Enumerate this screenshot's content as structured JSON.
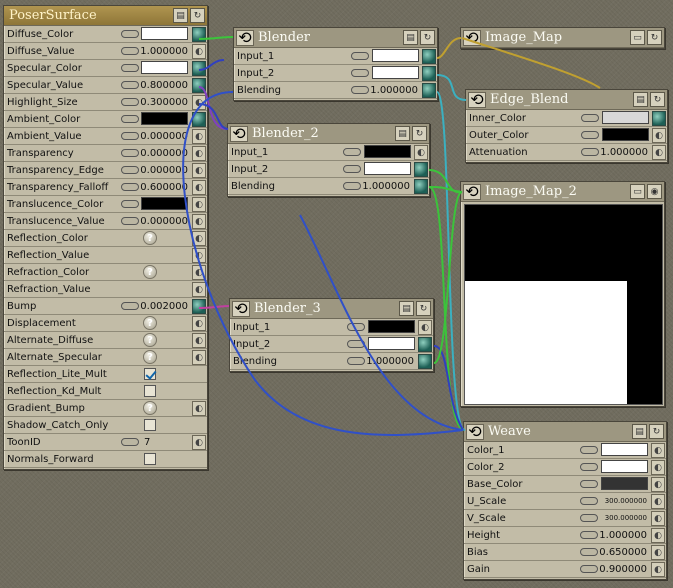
{
  "nodes": {
    "poser_surface": {
      "title": "PoserSurface"
    },
    "blender": {
      "title": "Blender"
    },
    "image_map": {
      "title": "Image_Map"
    },
    "blender_2": {
      "title": "Blender_2"
    },
    "edge_blend": {
      "title": "Edge_Blend"
    },
    "image_map_2": {
      "title": "Image_Map_2"
    },
    "blender_3": {
      "title": "Blender_3"
    },
    "weave": {
      "title": "Weave"
    }
  },
  "poser": [
    {
      "label": "Diffuse_Color",
      "swatch": "#ffffff",
      "connected": true
    },
    {
      "label": "Diffuse_Value",
      "value": "1.000000"
    },
    {
      "label": "Specular_Color",
      "swatch": "#ffffff",
      "connected": true
    },
    {
      "label": "Specular_Value",
      "value": "0.800000",
      "connected": true
    },
    {
      "label": "Highlight_Size",
      "value": "0.300000"
    },
    {
      "label": "Ambient_Color",
      "swatch": "#000000",
      "connected": true
    },
    {
      "label": "Ambient_Value",
      "value": "0.000000"
    },
    {
      "label": "Transparency",
      "value": "0.000000"
    },
    {
      "label": "Transparency_Edge",
      "value": "0.000000"
    },
    {
      "label": "Transparency_Falloff",
      "value": "0.600000"
    },
    {
      "label": "Translucence_Color",
      "swatch": "#000000"
    },
    {
      "label": "Translucence_Value",
      "value": "0.000000"
    },
    {
      "label": "Reflection_Color",
      "q": true
    },
    {
      "label": "Reflection_Value"
    },
    {
      "label": "Refraction_Color",
      "q": true
    },
    {
      "label": "Refraction_Value"
    },
    {
      "label": "Bump",
      "value": "0.002000",
      "connected": true
    },
    {
      "label": "Displacement",
      "q": true
    },
    {
      "label": "Alternate_Diffuse",
      "q": true
    },
    {
      "label": "Alternate_Specular",
      "q": true
    },
    {
      "label": "Reflection_Lite_Mult",
      "checkbox": true,
      "checked": true
    },
    {
      "label": "Reflection_Kd_Mult",
      "checkbox": true,
      "checked": false
    },
    {
      "label": "Gradient_Bump",
      "q": true
    },
    {
      "label": "Shadow_Catch_Only",
      "checkbox": true,
      "checked": false
    },
    {
      "label": "ToonID",
      "value": "7",
      "link": true
    },
    {
      "label": "Normals_Forward",
      "checkbox": true,
      "checked": false
    }
  ],
  "blender_rows": [
    {
      "label": "Input_1",
      "swatch": "#ffffff",
      "connected": true
    },
    {
      "label": "Input_2",
      "swatch": "#ffffff",
      "connected": true
    },
    {
      "label": "Blending",
      "value": "1.000000",
      "connected": true
    }
  ],
  "blender2_rows": [
    {
      "label": "Input_1",
      "swatch": "#000000"
    },
    {
      "label": "Input_2",
      "swatch": "#ffffff",
      "connected": true
    },
    {
      "label": "Blending",
      "value": "1.000000",
      "connected": true
    }
  ],
  "blender3_rows": [
    {
      "label": "Input_1",
      "swatch": "#000000"
    },
    {
      "label": "Input_2",
      "swatch": "#ffffff",
      "connected": true
    },
    {
      "label": "Blending",
      "value": "1.000000",
      "connected": true
    }
  ],
  "edge_rows": [
    {
      "label": "Inner_Color",
      "swatch": "#d8d8d8",
      "connected": true
    },
    {
      "label": "Outer_Color",
      "swatch": "#000000"
    },
    {
      "label": "Attenuation",
      "value": "1.000000"
    }
  ],
  "weave_rows": [
    {
      "label": "Color_1",
      "swatch": "#ffffff"
    },
    {
      "label": "Color_2",
      "swatch": "#ffffff"
    },
    {
      "label": "Base_Color",
      "swatch": "#333333"
    },
    {
      "label": "U_Scale",
      "value": "300.000000",
      "small": true
    },
    {
      "label": "V_Scale",
      "value": "300.000000",
      "small": true
    },
    {
      "label": "Height",
      "value": "1.000000"
    },
    {
      "label": "Bias",
      "value": "0.650000"
    },
    {
      "label": "Gain",
      "value": "0.900000"
    }
  ]
}
